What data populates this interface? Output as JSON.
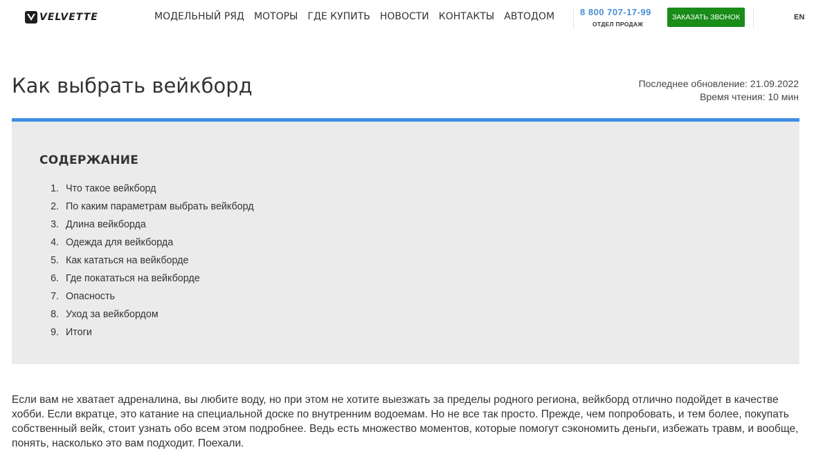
{
  "header": {
    "logo_text": "VELVETTE",
    "nav": [
      "МОДЕЛЬНЫЙ РЯД",
      "МОТОРЫ",
      "ГДЕ КУПИТЬ",
      "НОВОСТИ",
      "КОНТАКТЫ",
      "АВТОДОМ"
    ],
    "phone": "8 800 707-17-99",
    "phone_caption": "ОТДЕЛ ПРОДАЖ",
    "call_button": "ЗАКАЗАТЬ ЗВОНОК",
    "language": "EN"
  },
  "article": {
    "title": "Как выбрать вейкборд",
    "last_update": "Последнее обновление: 21.09.2022",
    "reading_time": "Время чтения: 10 мин"
  },
  "toc": {
    "heading": "СОДЕРЖАНИЕ",
    "items": [
      {
        "num": "1.",
        "label": "Что такое вейкборд"
      },
      {
        "num": "2.",
        "label": "По каким параметрам выбрать вейкборд"
      },
      {
        "num": "3.",
        "label": "Длина вейкборда"
      },
      {
        "num": "4.",
        "label": "Одежда для вейкборда"
      },
      {
        "num": "5.",
        "label": "Как кататься на вейкборде"
      },
      {
        "num": "6.",
        "label": "Где покататься на вейкборде"
      },
      {
        "num": "7.",
        "label": "Опасность"
      },
      {
        "num": "8.",
        "label": "Уход за вейкбордом"
      },
      {
        "num": "9.",
        "label": "Итоги"
      }
    ]
  },
  "intro": "Если вам не хватает адреналина, вы любите воду, но при этом не хотите выезжать за пределы родного региона, вейкборд отлично подойдет в качестве хобби. Если вкратце, это катание на специальной доске по внутренним водоемам. Но не все так просто. Прежде, чем попробовать, и тем более, покупать собственный вейк, стоит узнать обо всем этом подробнее. Ведь есть множество моментов, которые помогут сэкономить деньги, избежать травм, и вообще, понять, насколько это вам подходит. Поехали.",
  "colors": {
    "accent_blue": "#3e8ee8",
    "phone_blue": "#4a8ed3",
    "button_green": "#198c19",
    "toc_background": "#ebebeb"
  },
  "icons": {
    "logo": "velvette-v-logo-icon"
  }
}
